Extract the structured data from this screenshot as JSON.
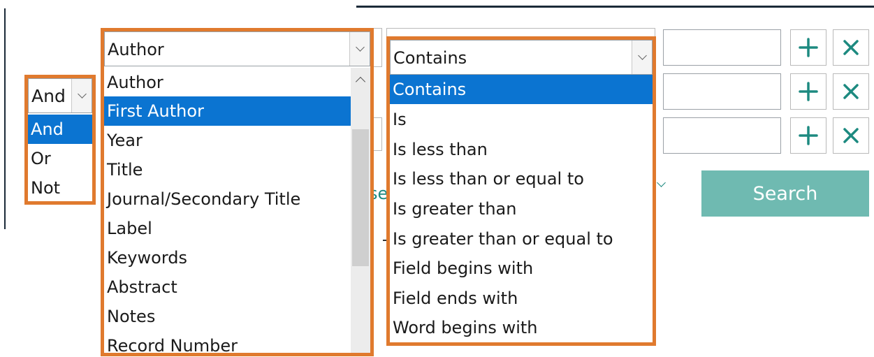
{
  "boolean_combo": {
    "value": "And",
    "options": [
      {
        "label": "And",
        "selected": true
      },
      {
        "label": "Or",
        "selected": false
      },
      {
        "label": "Not",
        "selected": false
      }
    ]
  },
  "field_combo": {
    "value": "Author",
    "options": [
      {
        "label": "Author",
        "selected": false
      },
      {
        "label": "First Author",
        "selected": true
      },
      {
        "label": "Year",
        "selected": false
      },
      {
        "label": "Title",
        "selected": false
      },
      {
        "label": "Journal/Secondary Title",
        "selected": false
      },
      {
        "label": "Label",
        "selected": false
      },
      {
        "label": "Keywords",
        "selected": false
      },
      {
        "label": "Abstract",
        "selected": false
      },
      {
        "label": "Notes",
        "selected": false
      },
      {
        "label": "Record Number",
        "selected": false
      }
    ]
  },
  "condition_combo": {
    "value": "Contains",
    "options": [
      {
        "label": "Contains",
        "selected": true
      },
      {
        "label": "Is",
        "selected": false
      },
      {
        "label": "Is less than",
        "selected": false
      },
      {
        "label": "Is less than or equal to",
        "selected": false
      },
      {
        "label": "Is greater than",
        "selected": false
      },
      {
        "label": "Is greater than or equal to",
        "selected": false
      },
      {
        "label": "Field begins with",
        "selected": false
      },
      {
        "label": "Field ends with",
        "selected": false
      },
      {
        "label": "Word begins with",
        "selected": false
      }
    ]
  },
  "rows": [
    {
      "search_value": "",
      "add_icon": "plus-icon",
      "remove_icon": "x-icon"
    },
    {
      "search_value": "",
      "add_icon": "plus-icon",
      "remove_icon": "x-icon"
    },
    {
      "search_value": "",
      "add_icon": "plus-icon",
      "remove_icon": "x-icon"
    }
  ],
  "search_button": {
    "label": "Search"
  },
  "partial_text": "se",
  "colors": {
    "highlight_border": "#e07a2e",
    "selection": "#0b74d1",
    "accent_teal": "#1d8a80",
    "search_button": "#6fbab1"
  }
}
